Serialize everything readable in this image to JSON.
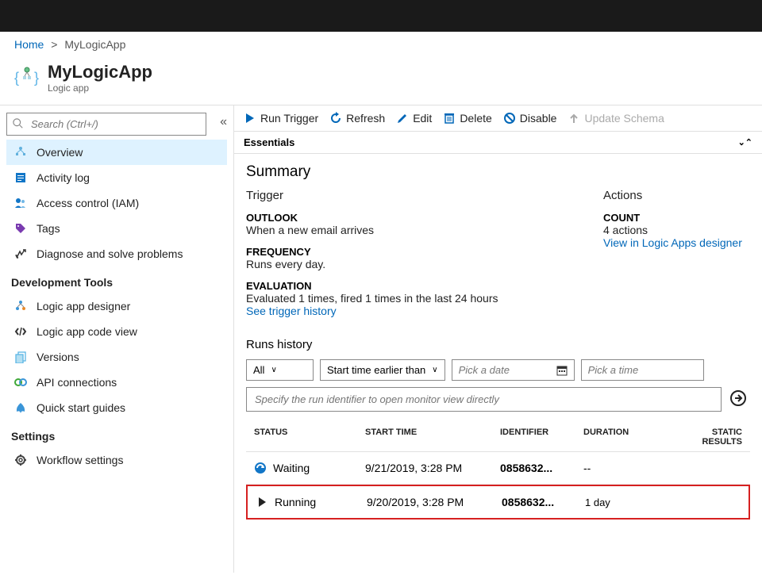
{
  "breadcrumb": {
    "home": "Home",
    "current": "MyLogicApp"
  },
  "header": {
    "title": "MyLogicApp",
    "subtitle": "Logic app"
  },
  "search_placeholder": "Search (Ctrl+/)",
  "sidebar": {
    "items_a": [
      {
        "label": "Overview"
      },
      {
        "label": "Activity log"
      },
      {
        "label": "Access control (IAM)"
      },
      {
        "label": "Tags"
      },
      {
        "label": "Diagnose and solve problems"
      }
    ],
    "heading_dev": "Development Tools",
    "items_dev": [
      {
        "label": "Logic app designer"
      },
      {
        "label": "Logic app code view"
      },
      {
        "label": "Versions"
      },
      {
        "label": "API connections"
      },
      {
        "label": "Quick start guides"
      }
    ],
    "heading_settings": "Settings",
    "items_settings": [
      {
        "label": "Workflow settings"
      }
    ]
  },
  "toolbar": {
    "run_trigger": "Run Trigger",
    "refresh": "Refresh",
    "edit": "Edit",
    "delete": "Delete",
    "disable": "Disable",
    "update_schema": "Update Schema"
  },
  "essentials_label": "Essentials",
  "summary": {
    "heading": "Summary",
    "trigger_label": "Trigger",
    "actions_label": "Actions",
    "outlook_h": "OUTLOOK",
    "outlook_t": "When a new email arrives",
    "freq_h": "FREQUENCY",
    "freq_t": "Runs every day.",
    "eval_h": "EVALUATION",
    "eval_t": "Evaluated 1 times, fired 1 times in the last 24 hours",
    "see_history": "See trigger history",
    "count_h": "COUNT",
    "count_t": "4 actions",
    "view_designer": "View in Logic Apps designer"
  },
  "runs": {
    "title": "Runs history",
    "filter_all": "All",
    "filter_start": "Start time earlier than",
    "pick_date": "Pick a date",
    "pick_time": "Pick a time",
    "search_placeholder": "Specify the run identifier to open monitor view directly",
    "cols": {
      "status": "STATUS",
      "start": "START TIME",
      "id": "IDENTIFIER",
      "dur": "DURATION",
      "static": "STATIC RESULTS"
    },
    "rows": [
      {
        "status": "Waiting",
        "start": "9/21/2019, 3:28 PM",
        "id": "0858632...",
        "dur": "--"
      },
      {
        "status": "Running",
        "start": "9/20/2019, 3:28 PM",
        "id": "0858632...",
        "dur": "1 day"
      }
    ]
  }
}
